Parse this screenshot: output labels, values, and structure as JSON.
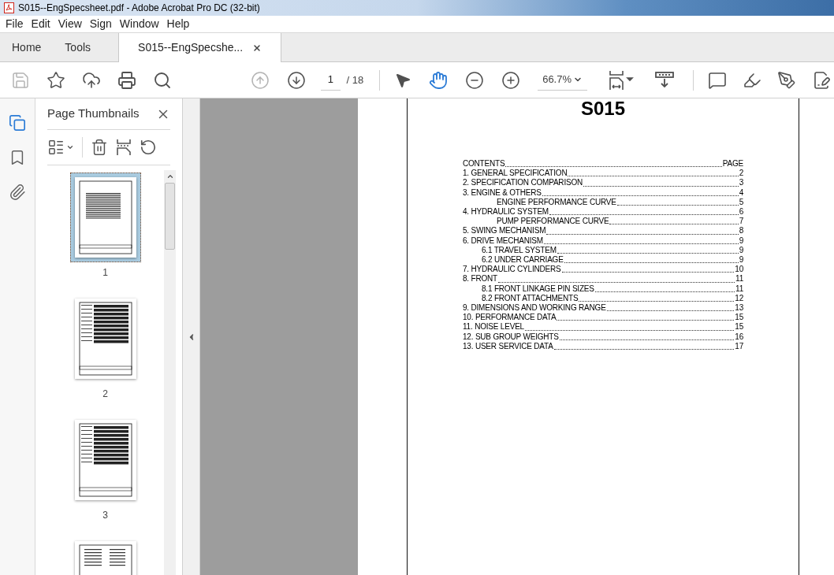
{
  "window": {
    "title": "S015--EngSpecsheet.pdf - Adobe Acrobat Pro DC (32-bit)"
  },
  "menu": [
    "File",
    "Edit",
    "View",
    "Sign",
    "Window",
    "Help"
  ],
  "tabs": [
    {
      "label": "Home",
      "selected": false,
      "closable": false
    },
    {
      "label": "Tools",
      "selected": false,
      "closable": false
    },
    {
      "label": "S015--EngSpecshe...",
      "selected": true,
      "closable": true
    }
  ],
  "toolbar": {
    "page_number": "1",
    "page_total": "/ 18",
    "zoom": "66.7%"
  },
  "sidebar": {
    "title": "Page Thumbnails",
    "thumbnails": [
      {
        "label": "1",
        "selected": true,
        "kind": "contents"
      },
      {
        "label": "2",
        "selected": false,
        "kind": "table"
      },
      {
        "label": "3",
        "selected": false,
        "kind": "table"
      },
      {
        "selected": false,
        "kind": "list"
      }
    ]
  },
  "document": {
    "heading": "S015",
    "contents_header": {
      "title": "CONTENTS",
      "page": "PAGE"
    },
    "entries": [
      {
        "title": "1. GENERAL SPECIFICATION",
        "page": "2"
      },
      {
        "title": "2. SPECIFICATION COMPARISON",
        "page": "3"
      },
      {
        "title": "3. ENGINE & OTHERS",
        "page": "4",
        "children": [
          {
            "title": "ENGINE PERFORMANCE CURVE",
            "page": "5",
            "kind": "curve"
          }
        ]
      },
      {
        "title": "4. HYDRAULIC SYSTEM",
        "page": "6",
        "children": [
          {
            "title": "PUMP PERFORMANCE CURVE",
            "page": "7",
            "kind": "curve"
          }
        ]
      },
      {
        "title": "5. SWING MECHANISM",
        "page": "8"
      },
      {
        "title": "6. DRIVE MECHANISM",
        "page": "9",
        "children": [
          {
            "title": "6.1 TRAVEL SYSTEM",
            "page": "9",
            "kind": "section"
          },
          {
            "title": "6.2 UNDER CARRIAGE",
            "page": "9",
            "kind": "section"
          }
        ]
      },
      {
        "title": "7. HYDRAULIC CYLINDERS",
        "page": "10"
      },
      {
        "title": "8. FRONT",
        "page": "11",
        "children": [
          {
            "title": "8.1 FRONT LINKAGE PIN SIZES",
            "page": "11",
            "kind": "section"
          },
          {
            "title": "8.2 FRONT ATTACHMENTS",
            "page": "12",
            "kind": "section"
          }
        ]
      },
      {
        "title": "9. DIMENSIONS AND WORKING RANGE",
        "page": "13"
      },
      {
        "title": "10. PERFORMANCE DATA",
        "page": "15"
      },
      {
        "title": "11. NOISE LEVEL",
        "page": "15"
      },
      {
        "title": "12. SUB GROUP WEIGHTS",
        "page": "16"
      },
      {
        "title": "13. USER SERVICE DATA",
        "page": "17"
      }
    ]
  }
}
